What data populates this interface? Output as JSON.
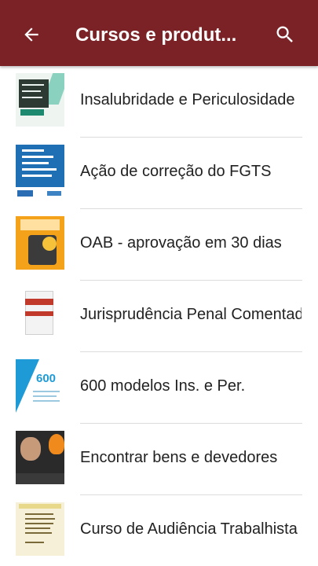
{
  "appbar": {
    "title": "Cursos e produt...",
    "back_icon": "arrow-back-icon",
    "search_icon": "search-icon",
    "background": "#7b2226"
  },
  "list": {
    "items": [
      {
        "label": "Insalubridade e Periculosidade",
        "thumbnail": "book-cover-insalubridade"
      },
      {
        "label": "Ação de correção do FGTS",
        "thumbnail": "book-cover-fgts"
      },
      {
        "label": "OAB - aprovação em 30 dias",
        "thumbnail": "book-cover-oab"
      },
      {
        "label": "Jurisprudência Penal Comentad",
        "thumbnail": "book-cover-jurisprudencia"
      },
      {
        "label": "600 modelos Ins. e Per.",
        "thumbnail": "book-cover-600-modelos"
      },
      {
        "label": "Encontrar bens e devedores",
        "thumbnail": "book-cover-bens-devedores"
      },
      {
        "label": "Curso de Audiência Trabalhista",
        "thumbnail": "book-cover-audiencia"
      }
    ]
  }
}
